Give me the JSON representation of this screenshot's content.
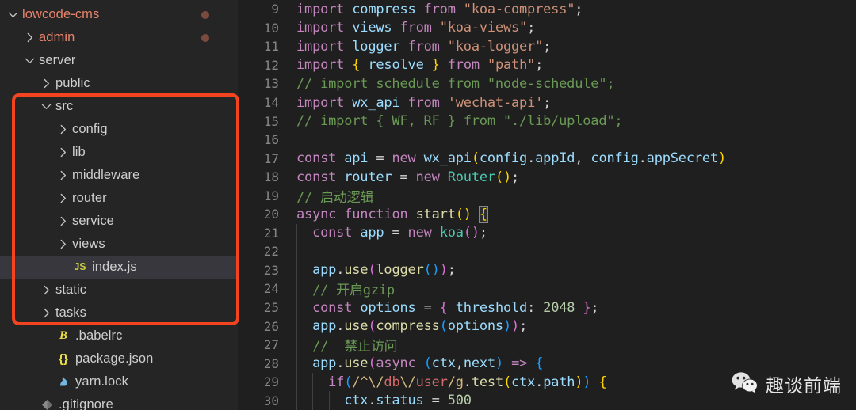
{
  "sidebar": {
    "tree": [
      {
        "label": "lowcode-cms",
        "indent": 0,
        "twisty": "down",
        "icon": "",
        "modified": true,
        "dot": true,
        "selected": false
      },
      {
        "label": "admin",
        "indent": 1,
        "twisty": "right",
        "icon": "",
        "modified": true,
        "dot": true,
        "selected": false
      },
      {
        "label": "server",
        "indent": 1,
        "twisty": "down",
        "icon": "",
        "modified": false,
        "dot": false,
        "selected": false
      },
      {
        "label": "public",
        "indent": 2,
        "twisty": "right",
        "icon": "",
        "modified": false,
        "dot": false,
        "selected": false
      },
      {
        "label": "src",
        "indent": 2,
        "twisty": "down",
        "icon": "",
        "modified": false,
        "dot": false,
        "selected": false
      },
      {
        "label": "config",
        "indent": 3,
        "twisty": "right",
        "icon": "",
        "modified": false,
        "dot": false,
        "selected": false
      },
      {
        "label": "lib",
        "indent": 3,
        "twisty": "right",
        "icon": "",
        "modified": false,
        "dot": false,
        "selected": false
      },
      {
        "label": "middleware",
        "indent": 3,
        "twisty": "right",
        "icon": "",
        "modified": false,
        "dot": false,
        "selected": false
      },
      {
        "label": "router",
        "indent": 3,
        "twisty": "right",
        "icon": "",
        "modified": false,
        "dot": false,
        "selected": false
      },
      {
        "label": "service",
        "indent": 3,
        "twisty": "right",
        "icon": "",
        "modified": false,
        "dot": false,
        "selected": false
      },
      {
        "label": "views",
        "indent": 3,
        "twisty": "right",
        "icon": "",
        "modified": false,
        "dot": false,
        "selected": false
      },
      {
        "label": "index.js",
        "indent": 3,
        "twisty": "none",
        "icon": "js",
        "modified": false,
        "dot": false,
        "selected": true
      },
      {
        "label": "static",
        "indent": 2,
        "twisty": "right",
        "icon": "",
        "modified": false,
        "dot": false,
        "selected": false
      },
      {
        "label": "tasks",
        "indent": 2,
        "twisty": "right",
        "icon": "",
        "modified": false,
        "dot": false,
        "selected": false
      },
      {
        "label": ".babelrc",
        "indent": 2,
        "twisty": "none",
        "icon": "babel",
        "modified": false,
        "dot": false,
        "selected": false
      },
      {
        "label": "package.json",
        "indent": 2,
        "twisty": "none",
        "icon": "json",
        "modified": false,
        "dot": false,
        "selected": false
      },
      {
        "label": "yarn.lock",
        "indent": 2,
        "twisty": "none",
        "icon": "yarn",
        "modified": false,
        "dot": false,
        "selected": false
      },
      {
        "label": ".gitignore",
        "indent": 1,
        "twisty": "none",
        "icon": "gitignore",
        "modified": false,
        "dot": false,
        "selected": false
      }
    ],
    "icon_labels": {
      "js": "JS",
      "babel": "B",
      "json": "{}",
      "yarn": "yarn-cat",
      "gitignore": "git-diamond"
    }
  },
  "annotation": {
    "type": "red-rectangle",
    "color": "#f4441f"
  },
  "editor": {
    "first_line_number": 9,
    "lines": [
      {
        "n": 9,
        "tokens": [
          {
            "t": "import",
            "c": "t-kw"
          },
          {
            "t": " ",
            "c": "t-op"
          },
          {
            "t": "compress",
            "c": "t-id"
          },
          {
            "t": " ",
            "c": "t-op"
          },
          {
            "t": "from",
            "c": "t-kw"
          },
          {
            "t": " ",
            "c": "t-op"
          },
          {
            "t": "\"koa-compress\"",
            "c": "t-str"
          },
          {
            "t": ";",
            "c": "t-op"
          }
        ]
      },
      {
        "n": 10,
        "tokens": [
          {
            "t": "import",
            "c": "t-kw"
          },
          {
            "t": " ",
            "c": "t-op"
          },
          {
            "t": "views",
            "c": "t-id"
          },
          {
            "t": " ",
            "c": "t-op"
          },
          {
            "t": "from",
            "c": "t-kw"
          },
          {
            "t": " ",
            "c": "t-op"
          },
          {
            "t": "\"koa-views\"",
            "c": "t-str"
          },
          {
            "t": ";",
            "c": "t-op"
          }
        ]
      },
      {
        "n": 11,
        "tokens": [
          {
            "t": "import",
            "c": "t-kw"
          },
          {
            "t": " ",
            "c": "t-op"
          },
          {
            "t": "logger",
            "c": "t-id"
          },
          {
            "t": " ",
            "c": "t-op"
          },
          {
            "t": "from",
            "c": "t-kw"
          },
          {
            "t": " ",
            "c": "t-op"
          },
          {
            "t": "\"koa-logger\"",
            "c": "t-str"
          },
          {
            "t": ";",
            "c": "t-op"
          }
        ]
      },
      {
        "n": 12,
        "tokens": [
          {
            "t": "import",
            "c": "t-kw"
          },
          {
            "t": " ",
            "c": "t-op"
          },
          {
            "t": "{",
            "c": "t-p1"
          },
          {
            "t": " ",
            "c": "t-op"
          },
          {
            "t": "resolve",
            "c": "t-id"
          },
          {
            "t": " ",
            "c": "t-op"
          },
          {
            "t": "}",
            "c": "t-p1"
          },
          {
            "t": " ",
            "c": "t-op"
          },
          {
            "t": "from",
            "c": "t-kw"
          },
          {
            "t": " ",
            "c": "t-op"
          },
          {
            "t": "\"path\"",
            "c": "t-str"
          },
          {
            "t": ";",
            "c": "t-op"
          }
        ]
      },
      {
        "n": 13,
        "tokens": [
          {
            "t": "// import schedule from \"node-schedule\";",
            "c": "t-com"
          }
        ]
      },
      {
        "n": 14,
        "tokens": [
          {
            "t": "import",
            "c": "t-kw"
          },
          {
            "t": " ",
            "c": "t-op"
          },
          {
            "t": "wx_api",
            "c": "t-id"
          },
          {
            "t": " ",
            "c": "t-op"
          },
          {
            "t": "from",
            "c": "t-kw"
          },
          {
            "t": " ",
            "c": "t-op"
          },
          {
            "t": "'wechat-api'",
            "c": "t-str"
          },
          {
            "t": ";",
            "c": "t-op"
          }
        ]
      },
      {
        "n": 15,
        "tokens": [
          {
            "t": "// import { WF, RF } from \"./lib/upload\";",
            "c": "t-com"
          }
        ]
      },
      {
        "n": 16,
        "tokens": []
      },
      {
        "n": 17,
        "tokens": [
          {
            "t": "const",
            "c": "t-kw"
          },
          {
            "t": " ",
            "c": "t-op"
          },
          {
            "t": "api",
            "c": "t-id"
          },
          {
            "t": " = ",
            "c": "t-op"
          },
          {
            "t": "new",
            "c": "t-kw"
          },
          {
            "t": " ",
            "c": "t-op"
          },
          {
            "t": "wx_api",
            "c": "t-id"
          },
          {
            "t": "(",
            "c": "t-p1"
          },
          {
            "t": "config",
            "c": "t-id"
          },
          {
            "t": ".",
            "c": "t-op"
          },
          {
            "t": "appId",
            "c": "t-prop"
          },
          {
            "t": ", ",
            "c": "t-op"
          },
          {
            "t": "config",
            "c": "t-id"
          },
          {
            "t": ".",
            "c": "t-op"
          },
          {
            "t": "appSecret",
            "c": "t-prop"
          },
          {
            "t": ")",
            "c": "t-p1"
          }
        ]
      },
      {
        "n": 18,
        "tokens": [
          {
            "t": "const",
            "c": "t-kw"
          },
          {
            "t": " ",
            "c": "t-op"
          },
          {
            "t": "router",
            "c": "t-id"
          },
          {
            "t": " = ",
            "c": "t-op"
          },
          {
            "t": "new",
            "c": "t-kw"
          },
          {
            "t": " ",
            "c": "t-op"
          },
          {
            "t": "Router",
            "c": "t-cls"
          },
          {
            "t": "(",
            "c": "t-p1"
          },
          {
            "t": ")",
            "c": "t-p1"
          },
          {
            "t": ";",
            "c": "t-op"
          }
        ]
      },
      {
        "n": 19,
        "tokens": [
          {
            "t": "// 启动逻辑",
            "c": "t-com"
          }
        ]
      },
      {
        "n": 20,
        "tokens": [
          {
            "t": "async",
            "c": "t-kw"
          },
          {
            "t": " ",
            "c": "t-op"
          },
          {
            "t": "function",
            "c": "t-kw"
          },
          {
            "t": " ",
            "c": "t-op"
          },
          {
            "t": "start",
            "c": "t-fn"
          },
          {
            "t": "(",
            "c": "t-p1"
          },
          {
            "t": ")",
            "c": "t-p1"
          },
          {
            "t": " ",
            "c": "t-op"
          },
          {
            "t": "{",
            "c": "t-p1 brkmatch"
          }
        ]
      },
      {
        "n": 21,
        "tokens": [
          {
            "t": "  ",
            "c": "t-op"
          },
          {
            "t": "const",
            "c": "t-kw"
          },
          {
            "t": " ",
            "c": "t-op"
          },
          {
            "t": "app",
            "c": "t-id"
          },
          {
            "t": " = ",
            "c": "t-op"
          },
          {
            "t": "new",
            "c": "t-kw"
          },
          {
            "t": " ",
            "c": "t-op"
          },
          {
            "t": "koa",
            "c": "t-cls"
          },
          {
            "t": "(",
            "c": "t-p2"
          },
          {
            "t": ")",
            "c": "t-p2"
          },
          {
            "t": ";",
            "c": "t-op"
          }
        ]
      },
      {
        "n": 22,
        "tokens": []
      },
      {
        "n": 23,
        "tokens": [
          {
            "t": "  ",
            "c": "t-op"
          },
          {
            "t": "app",
            "c": "t-id"
          },
          {
            "t": ".",
            "c": "t-op"
          },
          {
            "t": "use",
            "c": "t-fn"
          },
          {
            "t": "(",
            "c": "t-p2"
          },
          {
            "t": "logger",
            "c": "t-fn"
          },
          {
            "t": "(",
            "c": "t-p3"
          },
          {
            "t": ")",
            "c": "t-p3"
          },
          {
            "t": ")",
            "c": "t-p2"
          },
          {
            "t": ";",
            "c": "t-op"
          }
        ]
      },
      {
        "n": 24,
        "tokens": [
          {
            "t": "  ",
            "c": "t-op"
          },
          {
            "t": "// 开启gzip",
            "c": "t-com"
          }
        ]
      },
      {
        "n": 25,
        "tokens": [
          {
            "t": "  ",
            "c": "t-op"
          },
          {
            "t": "const",
            "c": "t-kw"
          },
          {
            "t": " ",
            "c": "t-op"
          },
          {
            "t": "options",
            "c": "t-id"
          },
          {
            "t": " = ",
            "c": "t-op"
          },
          {
            "t": "{",
            "c": "t-p2"
          },
          {
            "t": " ",
            "c": "t-op"
          },
          {
            "t": "threshold",
            "c": "t-id"
          },
          {
            "t": ": ",
            "c": "t-op"
          },
          {
            "t": "2048",
            "c": "t-num"
          },
          {
            "t": " ",
            "c": "t-op"
          },
          {
            "t": "}",
            "c": "t-p2"
          },
          {
            "t": ";",
            "c": "t-op"
          }
        ]
      },
      {
        "n": 26,
        "tokens": [
          {
            "t": "  ",
            "c": "t-op"
          },
          {
            "t": "app",
            "c": "t-id"
          },
          {
            "t": ".",
            "c": "t-op"
          },
          {
            "t": "use",
            "c": "t-fn"
          },
          {
            "t": "(",
            "c": "t-p2"
          },
          {
            "t": "compress",
            "c": "t-fn"
          },
          {
            "t": "(",
            "c": "t-p3"
          },
          {
            "t": "options",
            "c": "t-id"
          },
          {
            "t": ")",
            "c": "t-p3"
          },
          {
            "t": ")",
            "c": "t-p2"
          },
          {
            "t": ";",
            "c": "t-op"
          }
        ]
      },
      {
        "n": 27,
        "tokens": [
          {
            "t": "  ",
            "c": "t-op"
          },
          {
            "t": "//  禁止访问",
            "c": "t-com"
          }
        ]
      },
      {
        "n": 28,
        "tokens": [
          {
            "t": "  ",
            "c": "t-op"
          },
          {
            "t": "app",
            "c": "t-id"
          },
          {
            "t": ".",
            "c": "t-op"
          },
          {
            "t": "use",
            "c": "t-fn"
          },
          {
            "t": "(",
            "c": "t-p2"
          },
          {
            "t": "async",
            "c": "t-kw"
          },
          {
            "t": " ",
            "c": "t-op"
          },
          {
            "t": "(",
            "c": "t-p3"
          },
          {
            "t": "ctx",
            "c": "t-id"
          },
          {
            "t": ",",
            "c": "t-op"
          },
          {
            "t": "next",
            "c": "t-id"
          },
          {
            "t": ")",
            "c": "t-p3"
          },
          {
            "t": " ",
            "c": "t-op"
          },
          {
            "t": "=>",
            "c": "t-kw"
          },
          {
            "t": " ",
            "c": "t-op"
          },
          {
            "t": "{",
            "c": "t-p3"
          }
        ]
      },
      {
        "n": 29,
        "tokens": [
          {
            "t": "    ",
            "c": "t-op"
          },
          {
            "t": "if",
            "c": "t-kw"
          },
          {
            "t": "(",
            "c": "t-p3"
          },
          {
            "t": "/^",
            "c": "t-reop"
          },
          {
            "t": "\\/",
            "c": "t-reop"
          },
          {
            "t": "db",
            "c": "t-re"
          },
          {
            "t": "\\/",
            "c": "t-reop"
          },
          {
            "t": "user",
            "c": "t-re"
          },
          {
            "t": "/g",
            "c": "t-reop"
          },
          {
            "t": ".",
            "c": "t-op"
          },
          {
            "t": "test",
            "c": "t-fn"
          },
          {
            "t": "(",
            "c": "t-p1"
          },
          {
            "t": "ctx",
            "c": "t-id"
          },
          {
            "t": ".",
            "c": "t-op"
          },
          {
            "t": "path",
            "c": "t-prop"
          },
          {
            "t": ")",
            "c": "t-p1"
          },
          {
            "t": ")",
            "c": "t-p3"
          },
          {
            "t": " ",
            "c": "t-op"
          },
          {
            "t": "{",
            "c": "t-p1"
          }
        ]
      },
      {
        "n": 30,
        "tokens": [
          {
            "t": "      ",
            "c": "t-op"
          },
          {
            "t": "ctx",
            "c": "t-id"
          },
          {
            "t": ".",
            "c": "t-op"
          },
          {
            "t": "status",
            "c": "t-prop"
          },
          {
            "t": " = ",
            "c": "t-op"
          },
          {
            "t": "500",
            "c": "t-num"
          }
        ]
      }
    ]
  },
  "watermark": {
    "text": "趣谈前端",
    "icon": "wechat-logo"
  }
}
